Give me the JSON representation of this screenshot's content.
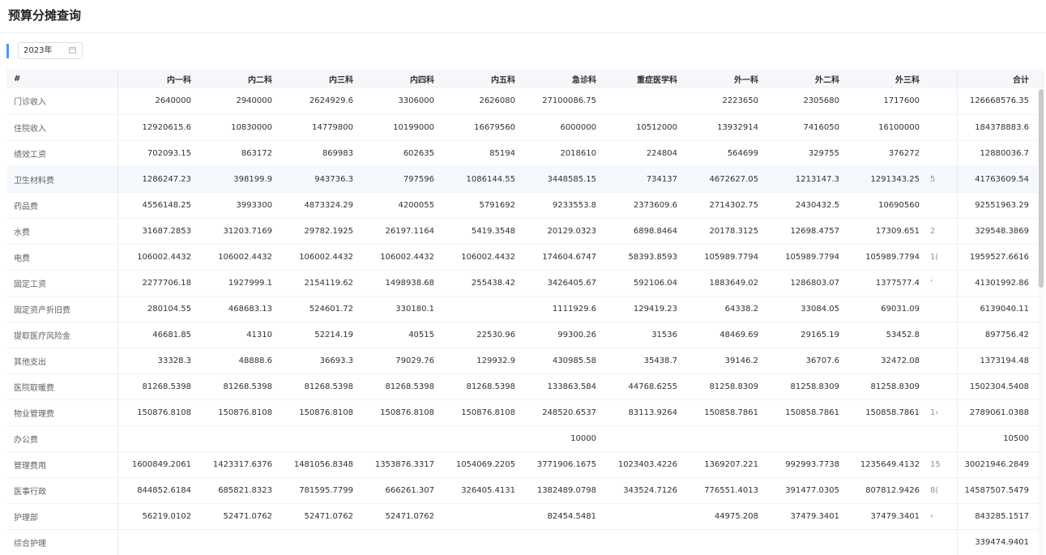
{
  "page": {
    "title": "预算分摊查询"
  },
  "filter": {
    "year_value": "2023年"
  },
  "table": {
    "columns": [
      "#",
      "内一科",
      "内二科",
      "内三科",
      "内四科",
      "内五科",
      "急诊科",
      "重症医学科",
      "外一科",
      "外二科",
      "外三科",
      "",
      "合计"
    ],
    "rows": [
      [
        "门诊收入",
        "2640000",
        "2940000",
        "2624929.6",
        "3306000",
        "2626080",
        "27100086.75",
        "",
        "2223650",
        "2305680",
        "1717600",
        "",
        "126668576.35"
      ],
      [
        "住院收入",
        "12920615.6",
        "10830000",
        "14779800",
        "10199000",
        "16679560",
        "6000000",
        "10512000",
        "13932914",
        "7416050",
        "16100000",
        "",
        "184378883.6"
      ],
      [
        "绩效工资",
        "702093.15",
        "863172",
        "869983",
        "602635",
        "85194",
        "2018610",
        "224804",
        "564699",
        "329755",
        "376272",
        "",
        "12880036.7"
      ],
      [
        "卫生材料费",
        "1286247.23",
        "398199.9",
        "943736.3",
        "797596",
        "1086144.55",
        "3448585.15",
        "734137",
        "4672627.05",
        "1213147.3",
        "1291343.25",
        "5",
        "41763609.54"
      ],
      [
        "药品费",
        "4556148.25",
        "3993300",
        "4873324.29",
        "4200055",
        "5791692",
        "9233553.8",
        "2373609.6",
        "2714302.75",
        "2430432.5",
        "10690560",
        "",
        "92551963.29"
      ],
      [
        "水费",
        "31687.2853",
        "31203.7169",
        "29782.1925",
        "26197.1164",
        "5419.3548",
        "20129.0323",
        "6898.8464",
        "20178.3125",
        "12698.4757",
        "17309.651",
        "2",
        "329548.3869"
      ],
      [
        "电费",
        "106002.4432",
        "106002.4432",
        "106002.4432",
        "106002.4432",
        "106002.4432",
        "174604.6747",
        "58393.8593",
        "105989.7794",
        "105989.7794",
        "105989.7794",
        "1(",
        "1959527.6616"
      ],
      [
        "固定工资",
        "2277706.18",
        "1927999.1",
        "2154119.62",
        "1498938.68",
        "255438.42",
        "3426405.67",
        "592106.04",
        "1883649.02",
        "1286803.07",
        "1377577.4",
        "'",
        "41301992.86"
      ],
      [
        "固定资产折旧费",
        "280104.55",
        "468683.13",
        "524601.72",
        "330180.1",
        "",
        "1111929.6",
        "129419.23",
        "64338.2",
        "33084.05",
        "69031.09",
        "",
        "6139040.11"
      ],
      [
        "提取医疗风险金",
        "46681.85",
        "41310",
        "52214.19",
        "40515",
        "22530.96",
        "99300.26",
        "31536",
        "48469.69",
        "29165.19",
        "53452.8",
        "",
        "897756.42"
      ],
      [
        "其他支出",
        "33328.3",
        "48888.6",
        "36693.3",
        "79029.76",
        "129932.9",
        "430985.58",
        "35438.7",
        "39146.2",
        "36707.6",
        "32472.08",
        "",
        "1373194.48"
      ],
      [
        "医院取暖费",
        "81268.5398",
        "81268.5398",
        "81268.5398",
        "81268.5398",
        "81268.5398",
        "133863.584",
        "44768.6255",
        "81258.8309",
        "81258.8309",
        "81258.8309",
        "",
        "1502304.5408"
      ],
      [
        "物业管理费",
        "150876.8108",
        "150876.8108",
        "150876.8108",
        "150876.8108",
        "150876.8108",
        "248520.6537",
        "83113.9264",
        "150858.7861",
        "150858.7861",
        "150858.7861",
        "1‹",
        "2789061.0388"
      ],
      [
        "办公费",
        "",
        "",
        "",
        "",
        "",
        "10000",
        "",
        "",
        "",
        "",
        "",
        "10500"
      ],
      [
        "管理费用",
        "1600849.2061",
        "1423317.6376",
        "1481056.8348",
        "1353876.3317",
        "1054069.2205",
        "3771906.1675",
        "1023403.4226",
        "1369207.221",
        "992993.7738",
        "1235649.4132",
        "15",
        "30021946.2849"
      ],
      [
        "医事行政",
        "844852.6184",
        "685821.8323",
        "781595.7799",
        "666261.307",
        "326405.4131",
        "1382489.0798",
        "343524.7126",
        "776551.4013",
        "391477.0305",
        "807812.9426",
        "8(",
        "14587507.5479"
      ],
      [
        "护理部",
        "56219.0102",
        "52471.0762",
        "52471.0762",
        "52471.0762",
        "",
        "82454.5481",
        "",
        "44975.208",
        "37479.3401",
        "37479.3401",
        "‹",
        "843285.1517"
      ],
      [
        "综合护理",
        "",
        "",
        "",
        "",
        "",
        "",
        "",
        "",
        "",
        "",
        "",
        "339474.9401"
      ]
    ]
  },
  "hover_row_index": 3
}
